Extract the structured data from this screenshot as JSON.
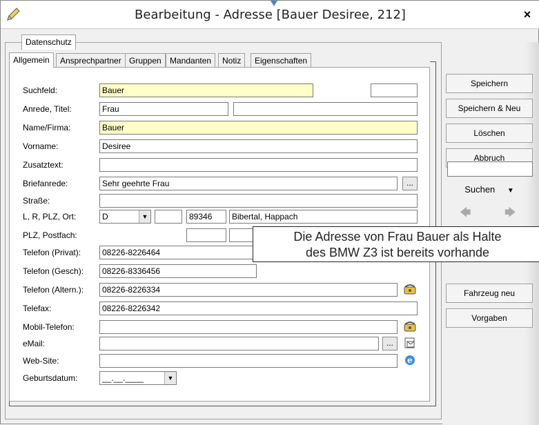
{
  "window": {
    "title": "Bearbeitung - Adresse [Bauer Desiree, 212]",
    "close_label": "×"
  },
  "tabs_top": [
    {
      "label": "Datenschutz"
    }
  ],
  "tabs": [
    {
      "label": "Allgemein",
      "active": true
    },
    {
      "label": "Ansprechpartner"
    },
    {
      "label": "Gruppen"
    },
    {
      "label": "Mandanten"
    },
    {
      "label": "Notiz"
    },
    {
      "label": "Eigenschaften"
    }
  ],
  "form": {
    "labels": {
      "suchfeld": "Suchfeld:",
      "anrede": "Anrede, Titel:",
      "name": "Name/Firma:",
      "vorname": "Vorname:",
      "zusatztext": "Zusatztext:",
      "briefanrede": "Briefanrede:",
      "strasse": "Straße:",
      "lrplzort": "L, R, PLZ, Ort:",
      "plzpostfach": "PLZ, Postfach:",
      "telprivat": "Telefon (Privat):",
      "telgesch": "Telefon (Gesch):",
      "telaltern": "Telefon (Altern.):",
      "telefax": "Telefax:",
      "mobil": "Mobil-Telefon:",
      "email": "eMail:",
      "website": "Web-Site:",
      "geburtsdatum": "Geburtsdatum:"
    },
    "values": {
      "suchfeld": "Bauer",
      "suchfeld2": "",
      "anrede": "Frau",
      "titel": "",
      "name": "Bauer",
      "vorname": "Desiree",
      "zusatztext": "",
      "briefanrede": "Sehr geehrte Frau",
      "strasse": "",
      "land": "D",
      "region": "",
      "plz": "89346",
      "ort": "Bibertal, Happach",
      "postfach_plz": "",
      "postfach": "",
      "telprivat": "08226-8226464",
      "telgesch": "08226-8336456",
      "telaltern": "08226-8226334",
      "telefax": "08226-8226342",
      "mobil": "",
      "email": "",
      "website": "",
      "geburtsdatum": "__.__.____"
    },
    "browse_label": "..."
  },
  "buttons": {
    "speichern": "Speichern",
    "speichern_neu": "Speichern & Neu",
    "loeschen": "Löschen",
    "abbruch": "Abbruch",
    "suchen": "Suchen",
    "fahrzeug_neu": "Fahrzeug neu",
    "vorgaben": "Vorgaben"
  },
  "search_value": "",
  "tooltip": {
    "line1": "Die Adresse von Frau Bauer als Halte",
    "line2": "des BMW Z3 ist bereits vorhande"
  },
  "colors": {
    "highlight_field": "#ffffc8",
    "tooltip_border": "#222222"
  },
  "icons": {
    "title": "pencil-icon",
    "phone": "phone-icon",
    "email": "email-icon",
    "web": "internet-explorer-icon",
    "prev": "arrow-left-icon",
    "next": "arrow-right-icon"
  }
}
